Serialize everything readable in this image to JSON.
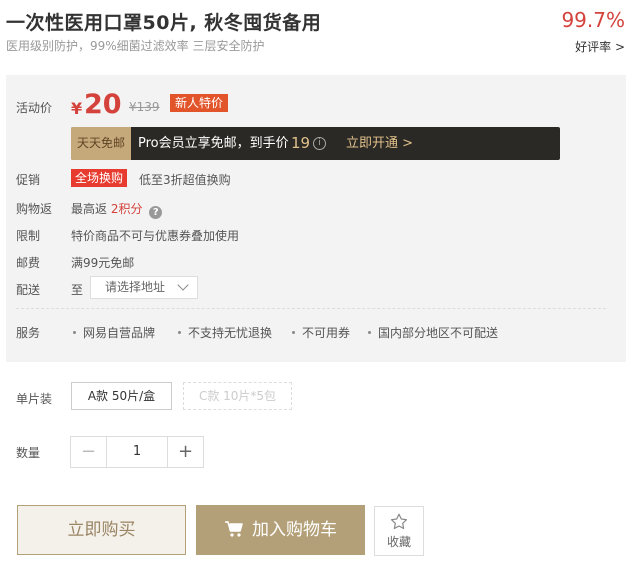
{
  "product": {
    "title": "一次性医用口罩50片, 秋冬囤货备用",
    "subtitle": "医用级别防护，99%细菌过滤效率 三层安全防护"
  },
  "rating": {
    "value": "99.7%",
    "label": "好评率 >"
  },
  "price": {
    "label": "活动价",
    "currency": "¥",
    "current": "20",
    "original": "¥139",
    "badge": "新人特价"
  },
  "vip": {
    "tag": "天天免邮",
    "text": "Pro会员立享免邮，到手价",
    "price": "19",
    "info_icon": "i",
    "cta": "立即开通 >"
  },
  "promo": {
    "label": "促销",
    "tag": "全场换购",
    "text": "低至3折超值换购"
  },
  "rebate": {
    "label": "购物返",
    "text_prefix": "最高返",
    "points": "2积分",
    "help_icon": "?"
  },
  "limit": {
    "label": "限制",
    "text": "特价商品不可与优惠券叠加使用"
  },
  "shipping": {
    "label": "邮费",
    "text": "满99元免邮"
  },
  "delivery": {
    "label": "配送",
    "prefix": "至",
    "select_value": "请选择地址"
  },
  "services": {
    "label": "服务",
    "items": [
      "网易自营品牌",
      "不支持无忧退换",
      "不可用券",
      "国内部分地区不可配送"
    ]
  },
  "spec": {
    "label": "单片装",
    "options": [
      {
        "label": "A款 50片/盒",
        "state": "selected"
      },
      {
        "label": "C款 10片*5包",
        "state": "disabled"
      }
    ]
  },
  "quantity": {
    "label": "数量",
    "minus": "−",
    "value": "1",
    "plus": "+"
  },
  "actions": {
    "buy": "立即购买",
    "cart": "加入购物车",
    "favorite": "收藏"
  },
  "colors": {
    "accent_red": "#d4423c",
    "gold": "#b4a078",
    "vip_bg": "#2b2925"
  }
}
